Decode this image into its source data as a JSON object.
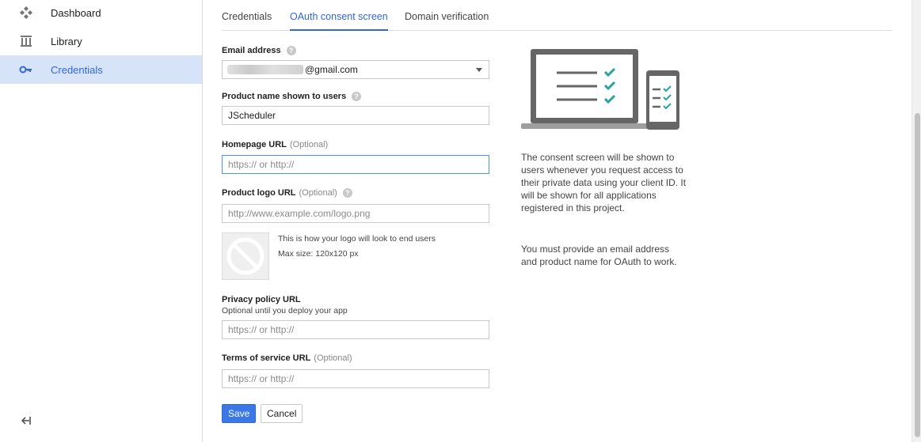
{
  "sidebar": {
    "items": [
      {
        "label": "Dashboard",
        "icon": "dashboard-icon"
      },
      {
        "label": "Library",
        "icon": "library-icon"
      },
      {
        "label": "Credentials",
        "icon": "key-icon",
        "active": true
      }
    ],
    "collapse_icon": "collapse-sidebar-icon"
  },
  "tabs": [
    {
      "label": "Credentials"
    },
    {
      "label": "OAuth consent screen",
      "active": true
    },
    {
      "label": "Domain verification"
    }
  ],
  "form": {
    "email": {
      "label": "Email address",
      "value_suffix": "@gmail.com"
    },
    "product_name": {
      "label": "Product name shown to users",
      "value": "JScheduler"
    },
    "homepage": {
      "label": "Homepage URL",
      "optional": "(Optional)",
      "placeholder": "https:// or http://"
    },
    "logo": {
      "label": "Product logo URL",
      "optional": "(Optional)",
      "placeholder": "http://www.example.com/logo.png",
      "preview_text": "This is how your logo will look to end users",
      "max_size": "Max size: 120x120 px"
    },
    "privacy": {
      "label": "Privacy policy URL",
      "sub": "Optional until you deploy your app",
      "placeholder": "https:// or http://"
    },
    "terms": {
      "label": "Terms of service URL",
      "optional": "(Optional)",
      "placeholder": "https:// or http://"
    },
    "save_label": "Save",
    "cancel_label": "Cancel"
  },
  "info": {
    "para1": "The consent screen will be shown to users whenever you request access to their private data using your client ID. It will be shown for all applications registered in this project.",
    "para2": "You must provide an email address and product name for OAuth to work."
  },
  "colors": {
    "accent": "#3367d6",
    "check": "#26a69a",
    "device": "#666666"
  }
}
